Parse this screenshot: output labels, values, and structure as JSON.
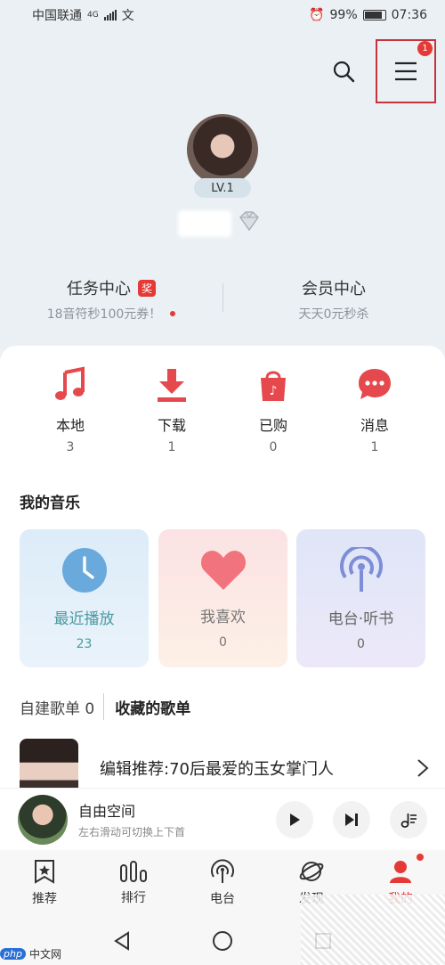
{
  "status_bar": {
    "carrier": "中国联通",
    "network": "4G",
    "extra": "文",
    "battery": "99%",
    "time": "07:36"
  },
  "menu": {
    "badge": "1"
  },
  "profile": {
    "level": "LV.1"
  },
  "task_center": {
    "title": "任务中心",
    "badge": "奖",
    "subtitle": "18音符秒100元券！"
  },
  "vip_center": {
    "title": "会员中心",
    "subtitle": "天天0元秒杀"
  },
  "quick_entries": [
    {
      "label": "本地",
      "count": "3"
    },
    {
      "label": "下载",
      "count": "1"
    },
    {
      "label": "已购",
      "count": "0"
    },
    {
      "label": "消息",
      "count": "1"
    }
  ],
  "my_music": {
    "title": "我的音乐",
    "tiles": [
      {
        "label": "最近播放",
        "count": "23"
      },
      {
        "label": "我喜欢",
        "count": "0"
      },
      {
        "label": "电台·听书",
        "count": "0"
      }
    ]
  },
  "playlist_tabs": {
    "created": "自建歌单 0",
    "collected": "收藏的歌单"
  },
  "playlist": {
    "title": "编辑推荐:70后最爱的玉女掌门人"
  },
  "player": {
    "title": "自由空间",
    "subtitle": "左右滑动可切换上下首"
  },
  "bottom_nav": [
    {
      "label": "推荐"
    },
    {
      "label": "排行"
    },
    {
      "label": "电台"
    },
    {
      "label": "发现"
    },
    {
      "label": "我的"
    }
  ],
  "watermark": {
    "logo": "php",
    "text": "中文网"
  },
  "colors": {
    "accent": "#e53935",
    "teal": "#4a9aa0"
  }
}
